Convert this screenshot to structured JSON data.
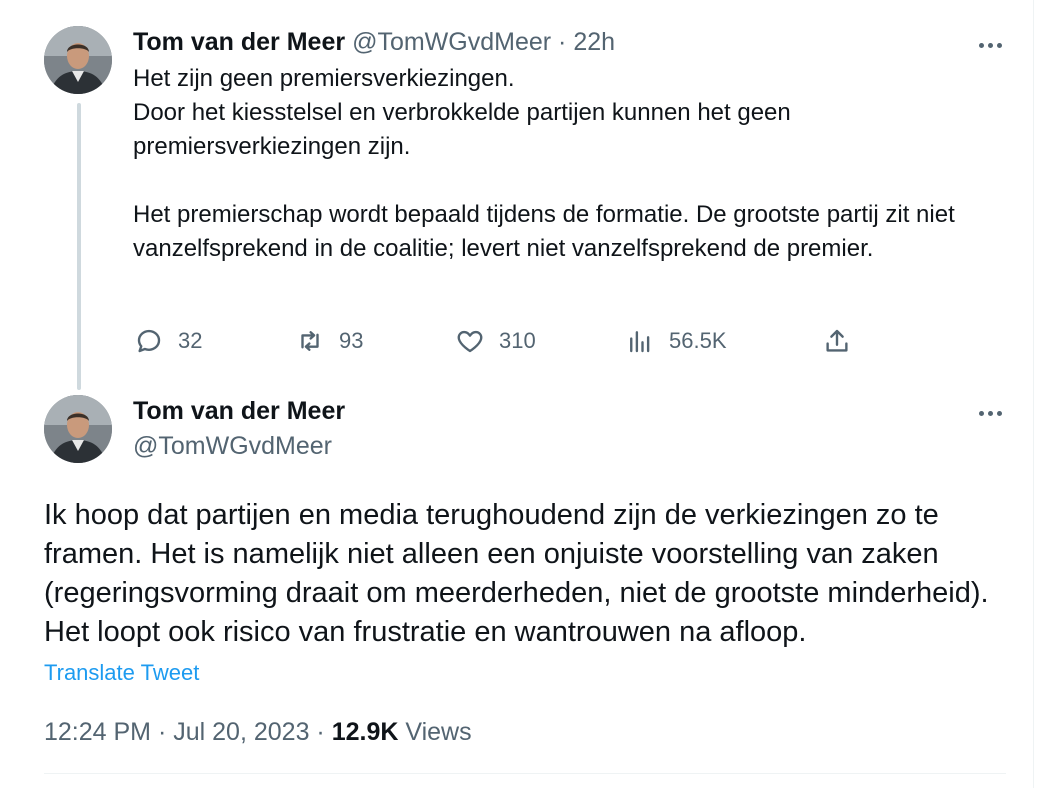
{
  "tweet1": {
    "author_name": "Tom van der Meer",
    "author_handle": "@TomWGvdMeer",
    "separator": "·",
    "time_ago": "22h",
    "lines": [
      "Het zijn geen premiersverkiezingen.",
      "Door het kiesstelsel en verbrokkelde partijen kunnen het geen premiersverkiezingen zijn.",
      "Het premierschap wordt bepaald tijdens de formatie. De grootste partij zit niet vanzelfsprekend in de coalitie; levert niet vanzelfsprekend de premier."
    ],
    "replies": "32",
    "retweets": "93",
    "likes": "310",
    "views": "56.5K"
  },
  "tweet2": {
    "author_name": "Tom van der Meer",
    "author_handle": "@TomWGvdMeer",
    "text": "Ik hoop dat partijen en media terughoudend zijn de verkiezingen zo te framen. Het is namelijk niet alleen een onjuiste voorstelling van zaken (regeringsvorming draait om meerderheden, niet de grootste minderheid). Het loopt ook risico van frustratie en wantrouwen na afloop.",
    "translate_label": "Translate Tweet",
    "time": "12:24 PM",
    "separator": "·",
    "date": "Jul 20, 2023",
    "views_count": "12.9K",
    "views_label": "Views"
  },
  "icons": {
    "reply": "reply-icon",
    "retweet": "retweet-icon",
    "like": "heart-icon",
    "views": "views-bar-chart-icon",
    "share": "share-icon",
    "more": "more-dots-icon"
  },
  "colors": {
    "text": "#0f1419",
    "muted": "#536471",
    "link": "#1d9bf0",
    "thread_line": "#cfd9de"
  }
}
